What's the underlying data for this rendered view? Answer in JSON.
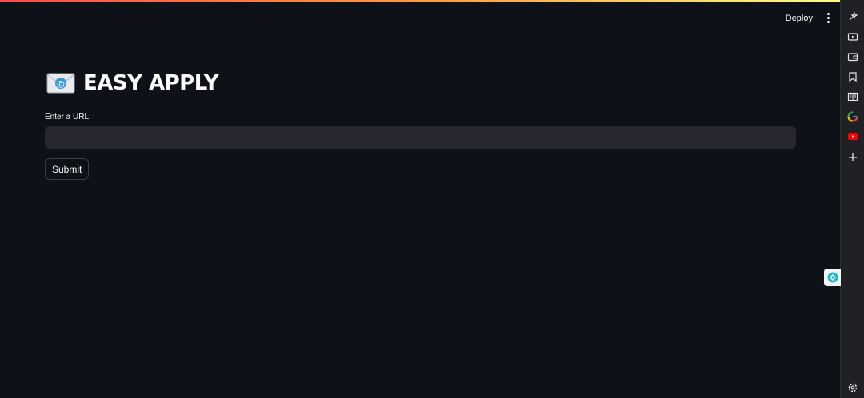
{
  "header": {
    "deploy_label": "Deploy"
  },
  "app": {
    "title": "EASY APPLY",
    "url_field": {
      "label": "Enter a URL:",
      "value": "",
      "placeholder": ""
    },
    "submit_label": "Submit"
  },
  "sidebar": {
    "icons": [
      "ai-sparkle-icon",
      "video-icon",
      "wallet-icon",
      "bookmark-icon",
      "reader-icon",
      "google-icon",
      "youtube-icon",
      "add-icon",
      "settings-icon"
    ]
  },
  "colors": {
    "background": "#0e1117",
    "input_bg": "#262730",
    "accent_gradient": [
      "#ff4b4b",
      "#fffd80"
    ]
  }
}
